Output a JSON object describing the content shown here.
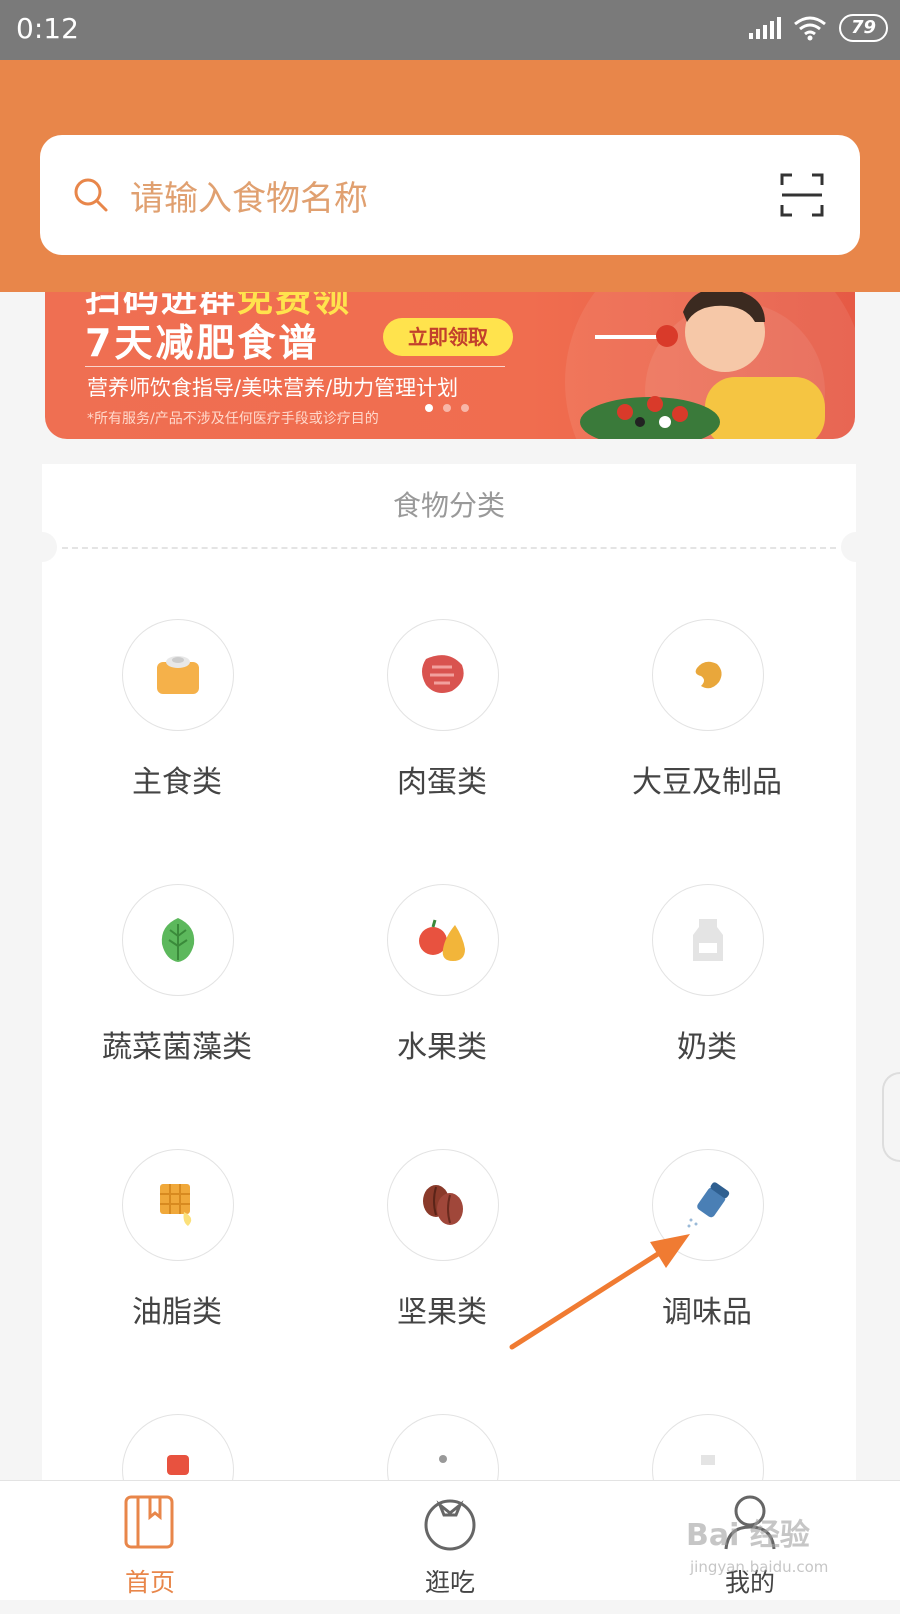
{
  "status_bar": {
    "time": "0:12",
    "battery": "79"
  },
  "search": {
    "placeholder": "请输入食物名称"
  },
  "banner": {
    "headline_part1": "扫码进群",
    "headline_highlight": "免费领",
    "title": "7天减肥食谱",
    "button_label": "立即领取",
    "subtitle": "营养师饮食指导/美味营养/助力管理计划",
    "note": "*所有服务/产品不涉及任何医疗手段或诊疗目的"
  },
  "categories_section": {
    "title": "食物分类",
    "items": [
      {
        "label": "主食类",
        "icon": "staple-food-icon"
      },
      {
        "label": "肉蛋类",
        "icon": "meat-icon"
      },
      {
        "label": "大豆及制品",
        "icon": "soybean-icon"
      },
      {
        "label": "蔬菜菌藻类",
        "icon": "vegetable-icon"
      },
      {
        "label": "水果类",
        "icon": "fruit-icon"
      },
      {
        "label": "奶类",
        "icon": "milk-icon"
      },
      {
        "label": "油脂类",
        "icon": "oil-fat-icon"
      },
      {
        "label": "坚果类",
        "icon": "nut-icon"
      },
      {
        "label": "调味品",
        "icon": "seasoning-icon"
      }
    ]
  },
  "tab_bar": {
    "tabs": [
      {
        "label": "首页",
        "icon": "home-book-icon",
        "active": true
      },
      {
        "label": "逛吃",
        "icon": "tomato-icon",
        "active": false
      },
      {
        "label": "我的",
        "icon": "profile-icon",
        "active": false
      }
    ]
  },
  "watermark": {
    "text": "Bai 经验",
    "sub": "jingyan.baidu.com"
  },
  "colors": {
    "accent": "#e8864a",
    "banner": "#ef6f52",
    "arrow": "#f07b32"
  }
}
